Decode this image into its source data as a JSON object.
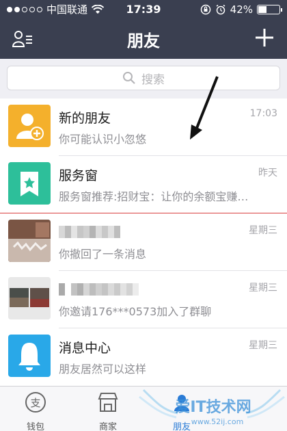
{
  "status": {
    "carrier": "中国联通",
    "time": "17:39",
    "battery": "42%",
    "battery_level": 0.42
  },
  "nav": {
    "title": "朋友"
  },
  "search": {
    "placeholder": "搜索"
  },
  "conversations": [
    {
      "name": "新的朋友",
      "message": "你可能认识小忽悠",
      "time": "17:03",
      "icon": "add-friend-icon",
      "color": "#f4b02c"
    },
    {
      "name": "服务窗",
      "message": "服务窗推荐:招财宝：让你的余额宝赚…",
      "time": "昨天",
      "icon": "bookmark-star-icon",
      "color": "#2dbf9a"
    },
    {
      "name": "",
      "message": "你撤回了一条消息",
      "time": "星期三",
      "icon": "photo-avatar"
    },
    {
      "name": "",
      "message": "你邀请176***0573加入了群聊",
      "time": "星期三",
      "icon": "group-photo-avatar"
    },
    {
      "name": "消息中心",
      "message": "朋友居然可以这样",
      "time": "星期三",
      "icon": "bell-icon",
      "color": "#29a8e8"
    }
  ],
  "tabs": [
    {
      "label": "钱包",
      "icon": "wallet-icon"
    },
    {
      "label": "商家",
      "icon": "shop-icon"
    },
    {
      "label": "朋友",
      "icon": "friends-icon"
    }
  ],
  "watermark": {
    "text": "爱IT技术网",
    "url": "www.52ij.com"
  }
}
